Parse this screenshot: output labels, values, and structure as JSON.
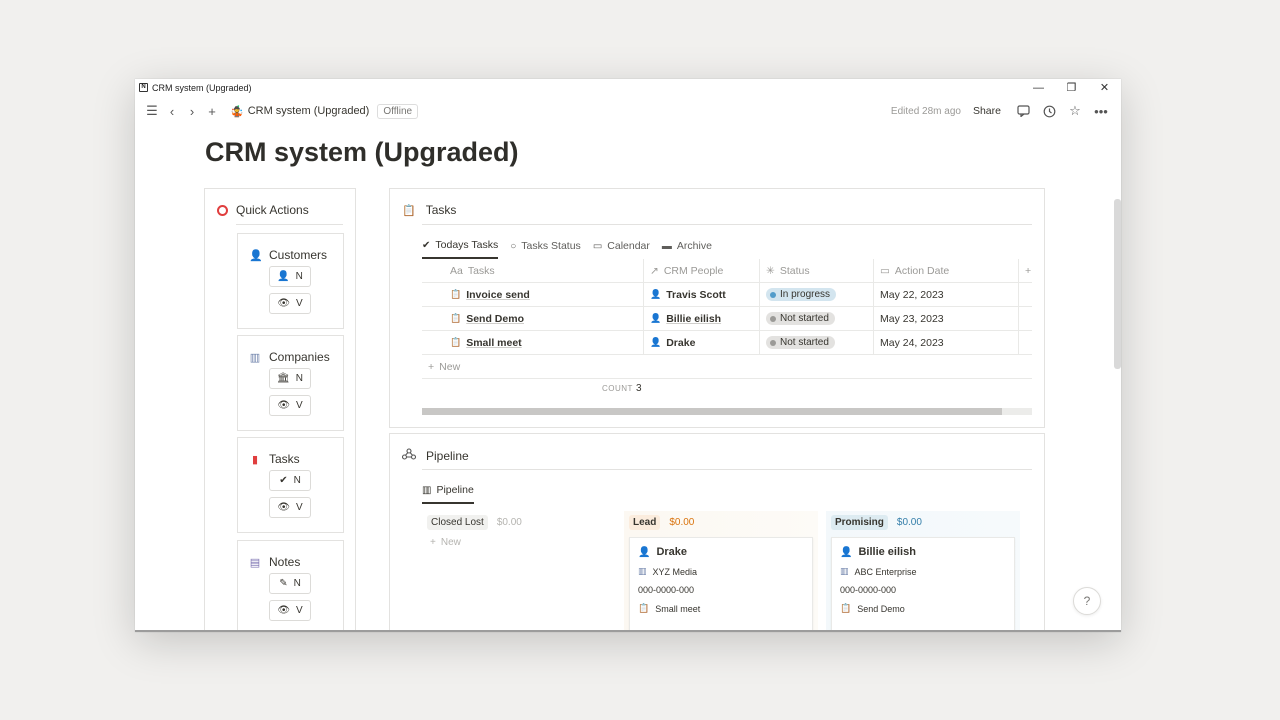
{
  "window": {
    "title": "CRM system (Upgraded)",
    "controls": {
      "minimize": "—",
      "restore": "❐",
      "close": "✕"
    }
  },
  "topbar": {
    "breadcrumb": "CRM system (Upgraded)",
    "offline": "Offline",
    "edited": "Edited 28m ago",
    "share": "Share"
  },
  "page": {
    "title": "CRM system (Upgraded)"
  },
  "quick_actions": {
    "title": "Quick Actions",
    "boxes": [
      {
        "label": "Customers",
        "icon": "person-icon",
        "btn_new": "N",
        "btn_view": "V"
      },
      {
        "label": "Companies",
        "icon": "building-icon",
        "btn_new": "N",
        "btn_view": "V"
      },
      {
        "label": "Tasks",
        "icon": "book-icon",
        "btn_new": "N",
        "btn_view": "V"
      },
      {
        "label": "Notes",
        "icon": "note-icon",
        "btn_new": "N",
        "btn_view": "V"
      }
    ]
  },
  "tasks": {
    "title": "Tasks",
    "tabs": [
      "Todays Tasks",
      "Tasks Status",
      "Calendar",
      "Archive"
    ],
    "columns": [
      "Tasks",
      "CRM People",
      "Status",
      "Action Date"
    ],
    "col_prefix": "Aa",
    "rows": [
      {
        "task": "Invoice send",
        "person": "Travis Scott",
        "status": "In progress",
        "date": "May 22, 2023"
      },
      {
        "task": "Send Demo",
        "person": "Billie eilish",
        "status": "Not started",
        "date": "May 23, 2023"
      },
      {
        "task": "Small meet",
        "person": "Drake",
        "status": "Not started",
        "date": "May 24, 2023"
      }
    ],
    "new_label": "New",
    "count_label": "COUNT",
    "count_value": "3"
  },
  "pipeline": {
    "title": "Pipeline",
    "tab": "Pipeline",
    "columns": [
      {
        "tag": "Closed Lost",
        "amount": "$0.00",
        "new_label": "New"
      },
      {
        "tag": "Lead",
        "amount": "$0.00",
        "card": {
          "name": "Drake",
          "company": "XYZ Media",
          "phone": "000-0000-000",
          "task": "Small meet"
        }
      },
      {
        "tag": "Promising",
        "amount": "$0.00",
        "card": {
          "name": "Billie eilish",
          "company": "ABC Enterprise",
          "phone": "000-0000-000",
          "task": "Send Demo"
        }
      }
    ]
  },
  "help": "?",
  "colors": {
    "in_progress_bg": "#d3e5ef",
    "in_progress_dot": "#529cca",
    "not_started_bg": "#e3e2e0",
    "not_started_dot": "#9b9a97",
    "lead_tag": "#fbecdd",
    "lead_amount": "#d9730d",
    "promising_tag": "#ddebf1",
    "promising_amount": "#337ea9"
  }
}
